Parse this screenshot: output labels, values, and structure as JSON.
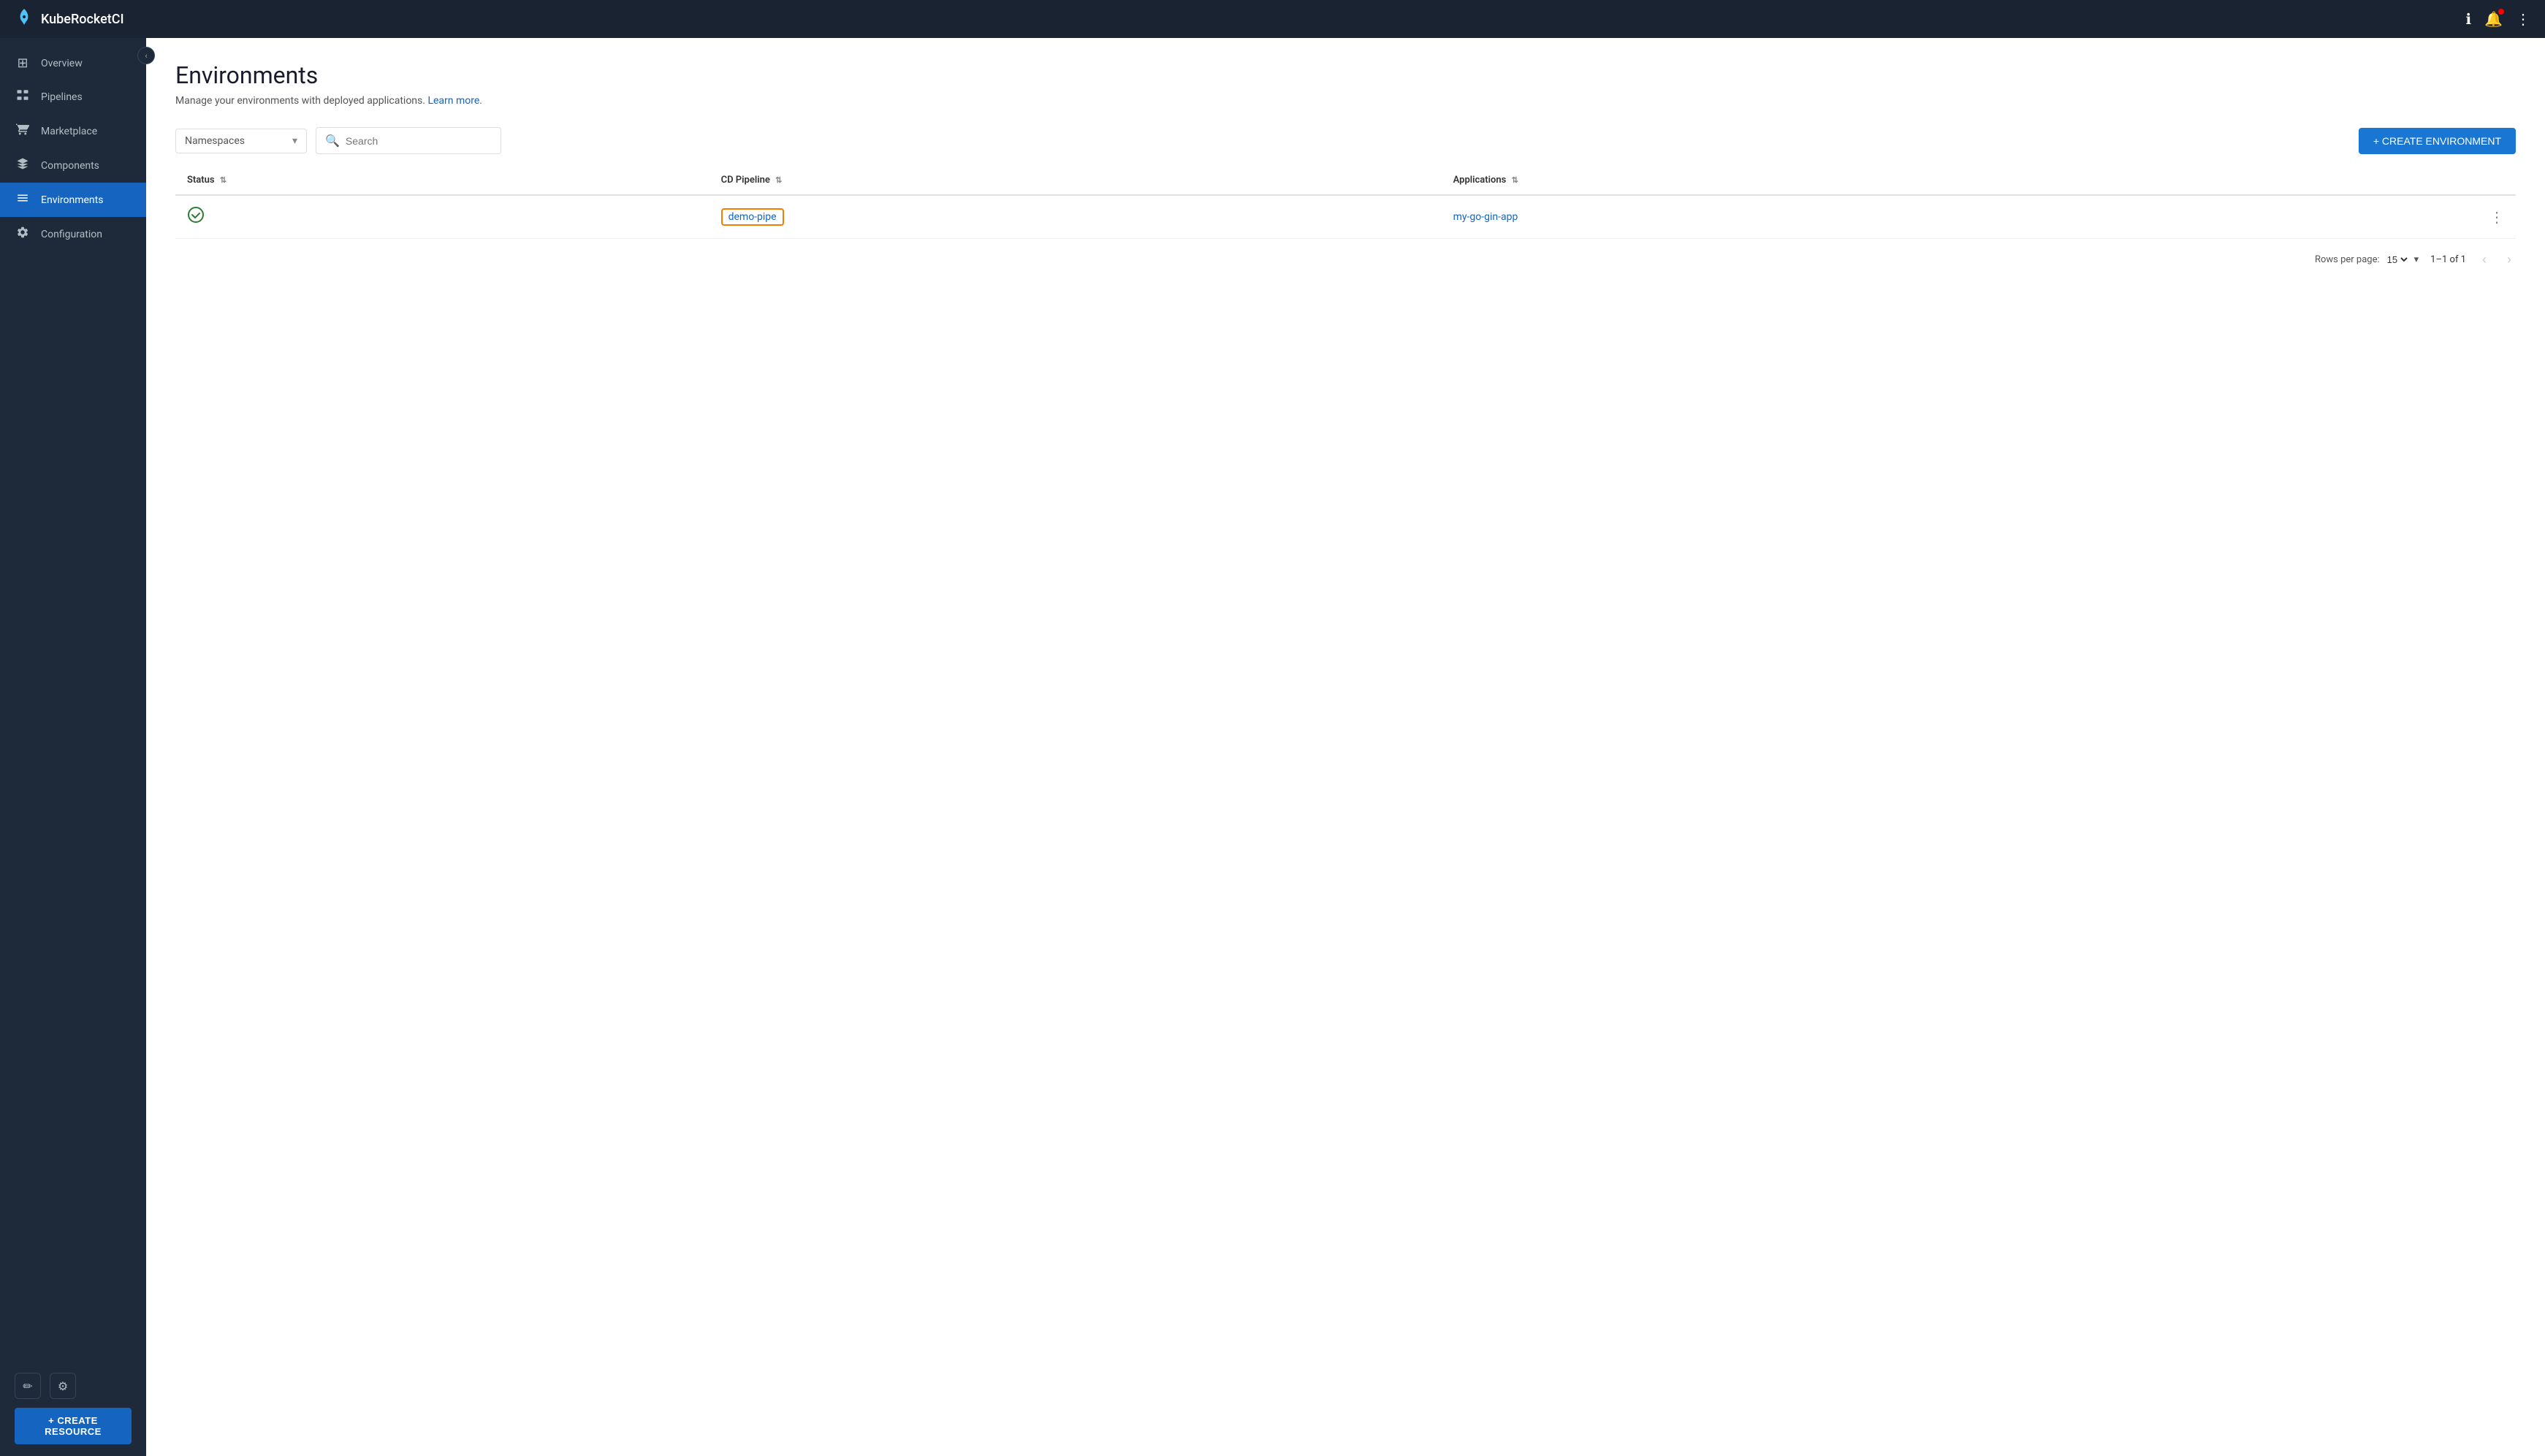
{
  "app": {
    "name": "KubeRocketCI",
    "logo": "🚀"
  },
  "navbar": {
    "info_icon": "ℹ",
    "notification_icon": "🔔",
    "menu_icon": "⋮"
  },
  "sidebar": {
    "collapse_icon": "‹",
    "items": [
      {
        "id": "overview",
        "label": "Overview",
        "icon": "⊞"
      },
      {
        "id": "pipelines",
        "label": "Pipelines",
        "icon": "📊"
      },
      {
        "id": "marketplace",
        "label": "Marketplace",
        "icon": "🛒"
      },
      {
        "id": "components",
        "label": "Components",
        "icon": "◈"
      },
      {
        "id": "environments",
        "label": "Environments",
        "icon": "☰",
        "active": true
      },
      {
        "id": "configuration",
        "label": "Configuration",
        "icon": "⚙"
      }
    ],
    "bottom_icons": [
      {
        "id": "edit",
        "icon": "✏"
      },
      {
        "id": "settings",
        "icon": "⚙"
      }
    ],
    "create_resource_label": "+ CREATE RESOURCE"
  },
  "page": {
    "title": "Environments",
    "subtitle": "Manage your environments with deployed applications.",
    "learn_more": "Learn more."
  },
  "toolbar": {
    "namespace_placeholder": "Namespaces",
    "search_placeholder": "Search",
    "create_button": "+ CREATE ENVIRONMENT"
  },
  "table": {
    "columns": [
      {
        "id": "status",
        "label": "Status"
      },
      {
        "id": "cd_pipeline",
        "label": "CD Pipeline"
      },
      {
        "id": "applications",
        "label": "Applications"
      }
    ],
    "rows": [
      {
        "status": "ok",
        "cd_pipeline": "demo-pipe",
        "applications": "my-go-gin-app"
      }
    ]
  },
  "pagination": {
    "rows_per_page_label": "Rows per page:",
    "rows_per_page_value": "15",
    "page_info": "1–1 of 1"
  }
}
